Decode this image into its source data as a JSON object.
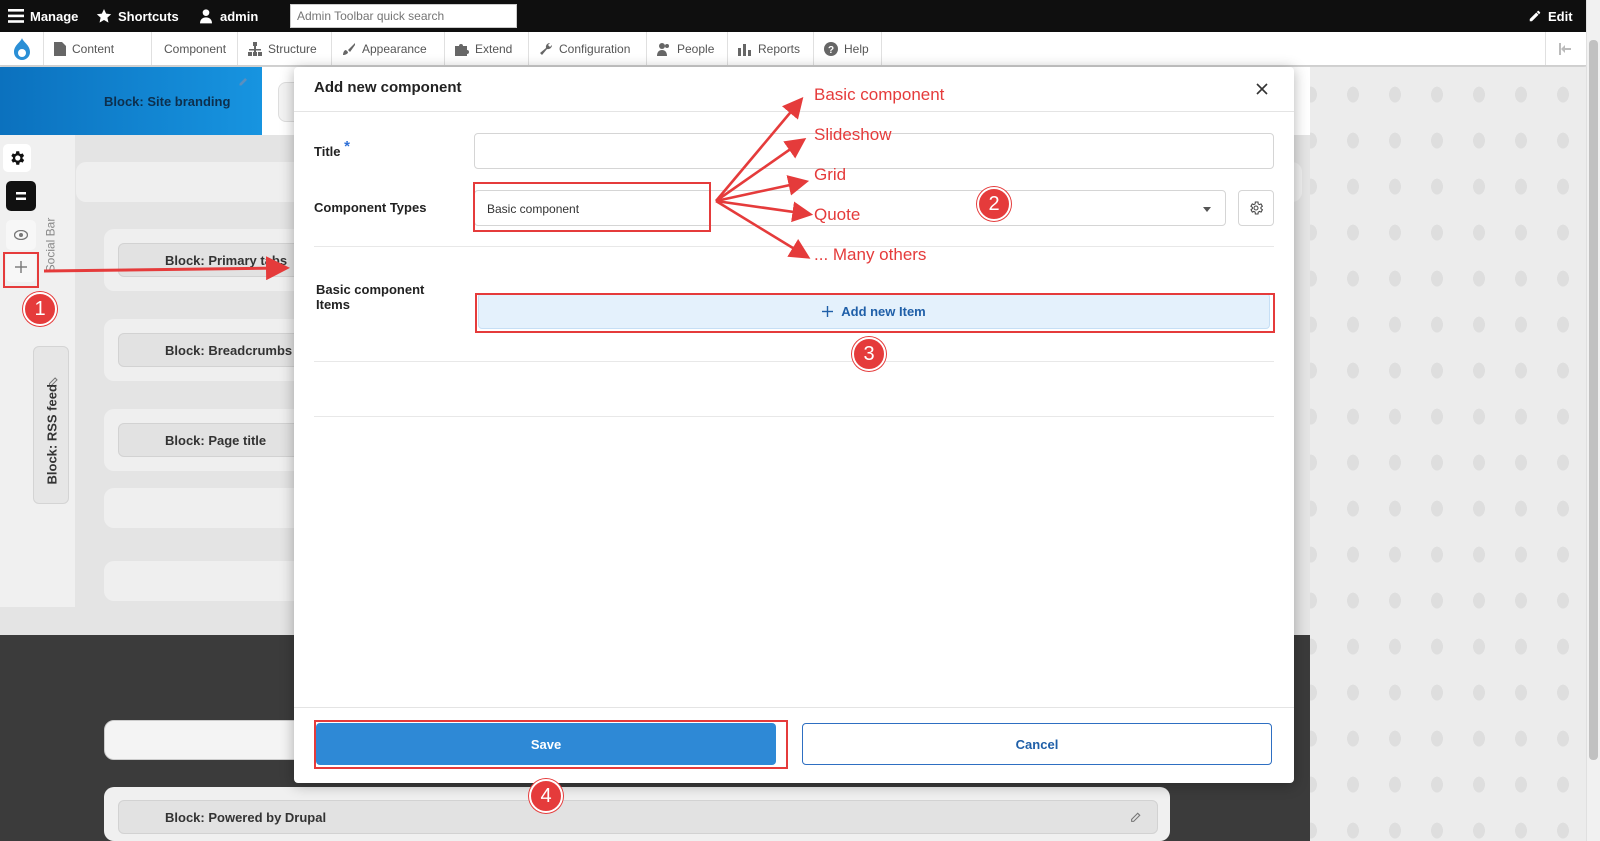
{
  "toolbar": {
    "manage": "Manage",
    "shortcuts": "Shortcuts",
    "user": "admin",
    "search_placeholder": "Admin Toolbar quick search",
    "edit": "Edit"
  },
  "menu": {
    "items": [
      "Content",
      "Component",
      "Structure",
      "Appearance",
      "Extend",
      "Configuration",
      "People",
      "Reports",
      "Help"
    ]
  },
  "background": {
    "site_branding": "Block: Site branding",
    "primary_tabs": "Block: Primary tabs",
    "breadcrumbs": "Block: Breadcrumbs",
    "page_title": "Block: Page title",
    "powered_by": "Block: Powered by Drupal",
    "social_bar": "Social Bar",
    "rss_feed": "Block: RSS feed"
  },
  "dialog": {
    "title": "Add new component",
    "title_label": "Title",
    "required_mark": "*",
    "title_value": "",
    "component_types_label": "Component Types",
    "component_type_selected": "Basic component",
    "items_label": "Basic component Items",
    "add_item": "Add new Item",
    "save": "Save",
    "cancel": "Cancel"
  },
  "annotations": {
    "options": [
      "Basic component",
      "Slideshow",
      "Grid",
      "Quote",
      "... Many others"
    ],
    "steps": [
      "1",
      "2",
      "3",
      "4"
    ],
    "color": "#e53b3b"
  },
  "colors": {
    "primary_blue": "#2e89d6",
    "toolbar_black": "#0f0f0f",
    "link_blue": "#1f5fa8"
  }
}
